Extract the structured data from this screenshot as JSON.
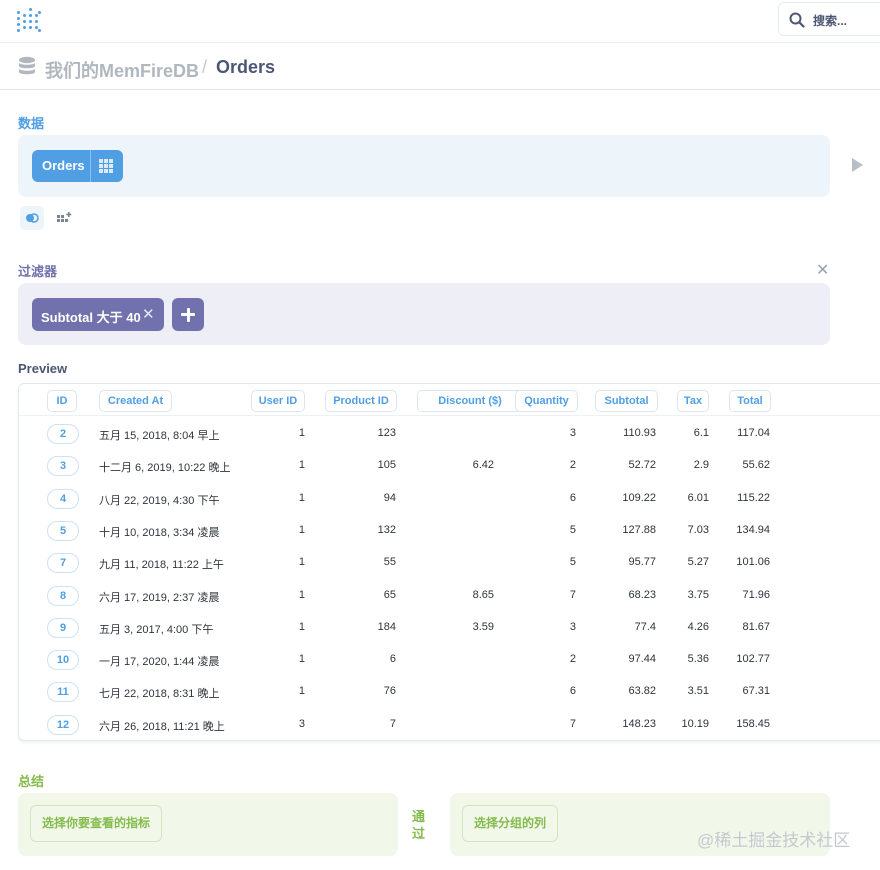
{
  "topbar": {
    "search_label": "搜索..."
  },
  "breadcrumb": {
    "database": "我们的MemFireDB",
    "separator": "/",
    "table": "Orders"
  },
  "data_section": {
    "title": "数据",
    "table_name": "Orders",
    "accent": "#509ee3"
  },
  "filter_section": {
    "title": "过滤器",
    "filter_label": "Subtotal 大于 40",
    "accent": "#7172ad"
  },
  "preview": {
    "title": "Preview",
    "columns": [
      "ID",
      "Created At",
      "User ID",
      "Product ID",
      "Discount ($)",
      "Quantity",
      "Subtotal",
      "Tax",
      "Total"
    ],
    "rows": [
      [
        "2",
        "五月 15, 2018, 8:04 早上",
        "1",
        "123",
        "",
        "3",
        "110.93",
        "6.1",
        "117.04"
      ],
      [
        "3",
        "十二月 6, 2019, 10:22 晚上",
        "1",
        "105",
        "6.42",
        "2",
        "52.72",
        "2.9",
        "55.62"
      ],
      [
        "4",
        "八月 22, 2019, 4:30 下午",
        "1",
        "94",
        "",
        "6",
        "109.22",
        "6.01",
        "115.22"
      ],
      [
        "5",
        "十月 10, 2018, 3:34 凌晨",
        "1",
        "132",
        "",
        "5",
        "127.88",
        "7.03",
        "134.94"
      ],
      [
        "7",
        "九月 11, 2018, 11:22 上午",
        "1",
        "55",
        "",
        "5",
        "95.77",
        "5.27",
        "101.06"
      ],
      [
        "8",
        "六月 17, 2019, 2:37 凌晨",
        "1",
        "65",
        "8.65",
        "7",
        "68.23",
        "3.75",
        "71.96"
      ],
      [
        "9",
        "五月 3, 2017, 4:00 下午",
        "1",
        "184",
        "3.59",
        "3",
        "77.4",
        "4.26",
        "81.67"
      ],
      [
        "10",
        "一月 17, 2020, 1:44 凌晨",
        "1",
        "6",
        "",
        "2",
        "97.44",
        "5.36",
        "102.77"
      ],
      [
        "11",
        "七月 22, 2018, 8:31 晚上",
        "1",
        "76",
        "",
        "6",
        "63.82",
        "3.51",
        "67.31"
      ],
      [
        "12",
        "六月 26, 2018, 11:21 晚上",
        "3",
        "7",
        "",
        "7",
        "148.23",
        "10.19",
        "158.45"
      ]
    ]
  },
  "summary_section": {
    "title": "总结",
    "metric_button": "选择你要查看的指标",
    "by_label": "通过",
    "group_button": "选择分组的列",
    "accent": "#84bb4c"
  },
  "watermark": "@稀土掘金技术社区"
}
